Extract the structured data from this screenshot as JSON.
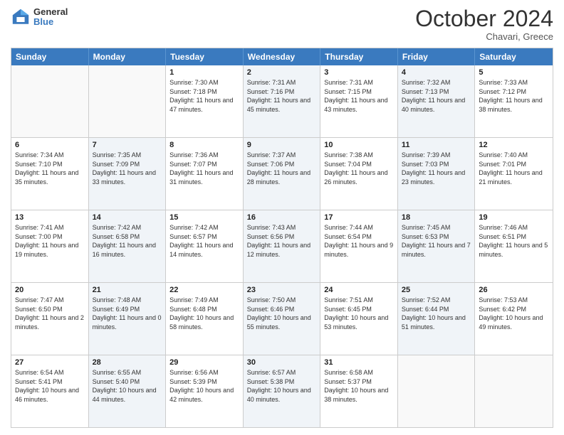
{
  "header": {
    "logo_line1": "General",
    "logo_line2": "Blue",
    "month": "October 2024",
    "location": "Chavari, Greece"
  },
  "weekdays": [
    "Sunday",
    "Monday",
    "Tuesday",
    "Wednesday",
    "Thursday",
    "Friday",
    "Saturday"
  ],
  "weeks": [
    [
      {
        "day": "",
        "sunrise": "",
        "sunset": "",
        "daylight": "",
        "shaded": false,
        "empty": true
      },
      {
        "day": "",
        "sunrise": "",
        "sunset": "",
        "daylight": "",
        "shaded": false,
        "empty": true
      },
      {
        "day": "1",
        "sunrise": "Sunrise: 7:30 AM",
        "sunset": "Sunset: 7:18 PM",
        "daylight": "Daylight: 11 hours and 47 minutes.",
        "shaded": false,
        "empty": false
      },
      {
        "day": "2",
        "sunrise": "Sunrise: 7:31 AM",
        "sunset": "Sunset: 7:16 PM",
        "daylight": "Daylight: 11 hours and 45 minutes.",
        "shaded": true,
        "empty": false
      },
      {
        "day": "3",
        "sunrise": "Sunrise: 7:31 AM",
        "sunset": "Sunset: 7:15 PM",
        "daylight": "Daylight: 11 hours and 43 minutes.",
        "shaded": false,
        "empty": false
      },
      {
        "day": "4",
        "sunrise": "Sunrise: 7:32 AM",
        "sunset": "Sunset: 7:13 PM",
        "daylight": "Daylight: 11 hours and 40 minutes.",
        "shaded": true,
        "empty": false
      },
      {
        "day": "5",
        "sunrise": "Sunrise: 7:33 AM",
        "sunset": "Sunset: 7:12 PM",
        "daylight": "Daylight: 11 hours and 38 minutes.",
        "shaded": false,
        "empty": false
      }
    ],
    [
      {
        "day": "6",
        "sunrise": "Sunrise: 7:34 AM",
        "sunset": "Sunset: 7:10 PM",
        "daylight": "Daylight: 11 hours and 35 minutes.",
        "shaded": false,
        "empty": false
      },
      {
        "day": "7",
        "sunrise": "Sunrise: 7:35 AM",
        "sunset": "Sunset: 7:09 PM",
        "daylight": "Daylight: 11 hours and 33 minutes.",
        "shaded": true,
        "empty": false
      },
      {
        "day": "8",
        "sunrise": "Sunrise: 7:36 AM",
        "sunset": "Sunset: 7:07 PM",
        "daylight": "Daylight: 11 hours and 31 minutes.",
        "shaded": false,
        "empty": false
      },
      {
        "day": "9",
        "sunrise": "Sunrise: 7:37 AM",
        "sunset": "Sunset: 7:06 PM",
        "daylight": "Daylight: 11 hours and 28 minutes.",
        "shaded": true,
        "empty": false
      },
      {
        "day": "10",
        "sunrise": "Sunrise: 7:38 AM",
        "sunset": "Sunset: 7:04 PM",
        "daylight": "Daylight: 11 hours and 26 minutes.",
        "shaded": false,
        "empty": false
      },
      {
        "day": "11",
        "sunrise": "Sunrise: 7:39 AM",
        "sunset": "Sunset: 7:03 PM",
        "daylight": "Daylight: 11 hours and 23 minutes.",
        "shaded": true,
        "empty": false
      },
      {
        "day": "12",
        "sunrise": "Sunrise: 7:40 AM",
        "sunset": "Sunset: 7:01 PM",
        "daylight": "Daylight: 11 hours and 21 minutes.",
        "shaded": false,
        "empty": false
      }
    ],
    [
      {
        "day": "13",
        "sunrise": "Sunrise: 7:41 AM",
        "sunset": "Sunset: 7:00 PM",
        "daylight": "Daylight: 11 hours and 19 minutes.",
        "shaded": false,
        "empty": false
      },
      {
        "day": "14",
        "sunrise": "Sunrise: 7:42 AM",
        "sunset": "Sunset: 6:58 PM",
        "daylight": "Daylight: 11 hours and 16 minutes.",
        "shaded": true,
        "empty": false
      },
      {
        "day": "15",
        "sunrise": "Sunrise: 7:42 AM",
        "sunset": "Sunset: 6:57 PM",
        "daylight": "Daylight: 11 hours and 14 minutes.",
        "shaded": false,
        "empty": false
      },
      {
        "day": "16",
        "sunrise": "Sunrise: 7:43 AM",
        "sunset": "Sunset: 6:56 PM",
        "daylight": "Daylight: 11 hours and 12 minutes.",
        "shaded": true,
        "empty": false
      },
      {
        "day": "17",
        "sunrise": "Sunrise: 7:44 AM",
        "sunset": "Sunset: 6:54 PM",
        "daylight": "Daylight: 11 hours and 9 minutes.",
        "shaded": false,
        "empty": false
      },
      {
        "day": "18",
        "sunrise": "Sunrise: 7:45 AM",
        "sunset": "Sunset: 6:53 PM",
        "daylight": "Daylight: 11 hours and 7 minutes.",
        "shaded": true,
        "empty": false
      },
      {
        "day": "19",
        "sunrise": "Sunrise: 7:46 AM",
        "sunset": "Sunset: 6:51 PM",
        "daylight": "Daylight: 11 hours and 5 minutes.",
        "shaded": false,
        "empty": false
      }
    ],
    [
      {
        "day": "20",
        "sunrise": "Sunrise: 7:47 AM",
        "sunset": "Sunset: 6:50 PM",
        "daylight": "Daylight: 11 hours and 2 minutes.",
        "shaded": false,
        "empty": false
      },
      {
        "day": "21",
        "sunrise": "Sunrise: 7:48 AM",
        "sunset": "Sunset: 6:49 PM",
        "daylight": "Daylight: 11 hours and 0 minutes.",
        "shaded": true,
        "empty": false
      },
      {
        "day": "22",
        "sunrise": "Sunrise: 7:49 AM",
        "sunset": "Sunset: 6:48 PM",
        "daylight": "Daylight: 10 hours and 58 minutes.",
        "shaded": false,
        "empty": false
      },
      {
        "day": "23",
        "sunrise": "Sunrise: 7:50 AM",
        "sunset": "Sunset: 6:46 PM",
        "daylight": "Daylight: 10 hours and 55 minutes.",
        "shaded": true,
        "empty": false
      },
      {
        "day": "24",
        "sunrise": "Sunrise: 7:51 AM",
        "sunset": "Sunset: 6:45 PM",
        "daylight": "Daylight: 10 hours and 53 minutes.",
        "shaded": false,
        "empty": false
      },
      {
        "day": "25",
        "sunrise": "Sunrise: 7:52 AM",
        "sunset": "Sunset: 6:44 PM",
        "daylight": "Daylight: 10 hours and 51 minutes.",
        "shaded": true,
        "empty": false
      },
      {
        "day": "26",
        "sunrise": "Sunrise: 7:53 AM",
        "sunset": "Sunset: 6:42 PM",
        "daylight": "Daylight: 10 hours and 49 minutes.",
        "shaded": false,
        "empty": false
      }
    ],
    [
      {
        "day": "27",
        "sunrise": "Sunrise: 6:54 AM",
        "sunset": "Sunset: 5:41 PM",
        "daylight": "Daylight: 10 hours and 46 minutes.",
        "shaded": false,
        "empty": false
      },
      {
        "day": "28",
        "sunrise": "Sunrise: 6:55 AM",
        "sunset": "Sunset: 5:40 PM",
        "daylight": "Daylight: 10 hours and 44 minutes.",
        "shaded": true,
        "empty": false
      },
      {
        "day": "29",
        "sunrise": "Sunrise: 6:56 AM",
        "sunset": "Sunset: 5:39 PM",
        "daylight": "Daylight: 10 hours and 42 minutes.",
        "shaded": false,
        "empty": false
      },
      {
        "day": "30",
        "sunrise": "Sunrise: 6:57 AM",
        "sunset": "Sunset: 5:38 PM",
        "daylight": "Daylight: 10 hours and 40 minutes.",
        "shaded": true,
        "empty": false
      },
      {
        "day": "31",
        "sunrise": "Sunrise: 6:58 AM",
        "sunset": "Sunset: 5:37 PM",
        "daylight": "Daylight: 10 hours and 38 minutes.",
        "shaded": false,
        "empty": false
      },
      {
        "day": "",
        "sunrise": "",
        "sunset": "",
        "daylight": "",
        "shaded": false,
        "empty": true
      },
      {
        "day": "",
        "sunrise": "",
        "sunset": "",
        "daylight": "",
        "shaded": false,
        "empty": true
      }
    ]
  ]
}
